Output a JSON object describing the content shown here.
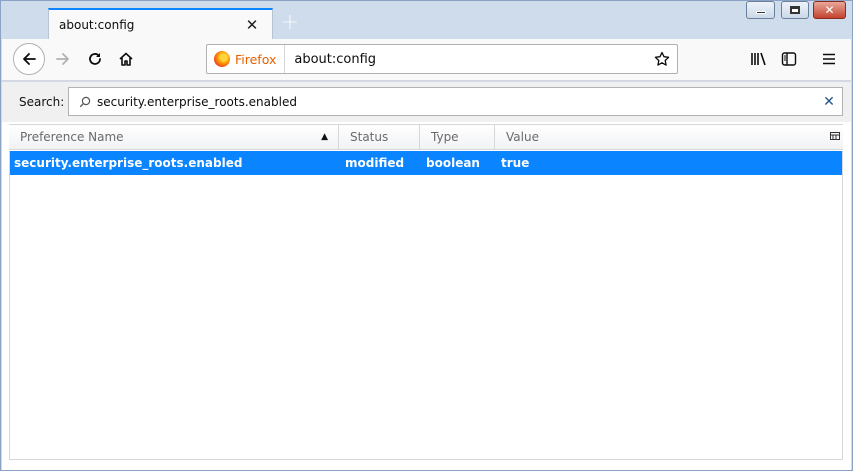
{
  "tab": {
    "title": "about:config"
  },
  "toolbar": {
    "identity_label": "Firefox",
    "url": "about:config"
  },
  "search": {
    "label": "Search:",
    "value": "security.enterprise_roots.enabled"
  },
  "table": {
    "columns": [
      "Preference Name",
      "Status",
      "Type",
      "Value"
    ],
    "sort_column": "Preference Name",
    "sort_direction": "ascending",
    "rows": [
      {
        "name": "security.enterprise_roots.enabled",
        "status": "modified",
        "type": "boolean",
        "value": "true"
      }
    ]
  },
  "colors": {
    "accent": "#0a84ff",
    "selected_row": "#0a84ff",
    "identity": "#e66000"
  }
}
